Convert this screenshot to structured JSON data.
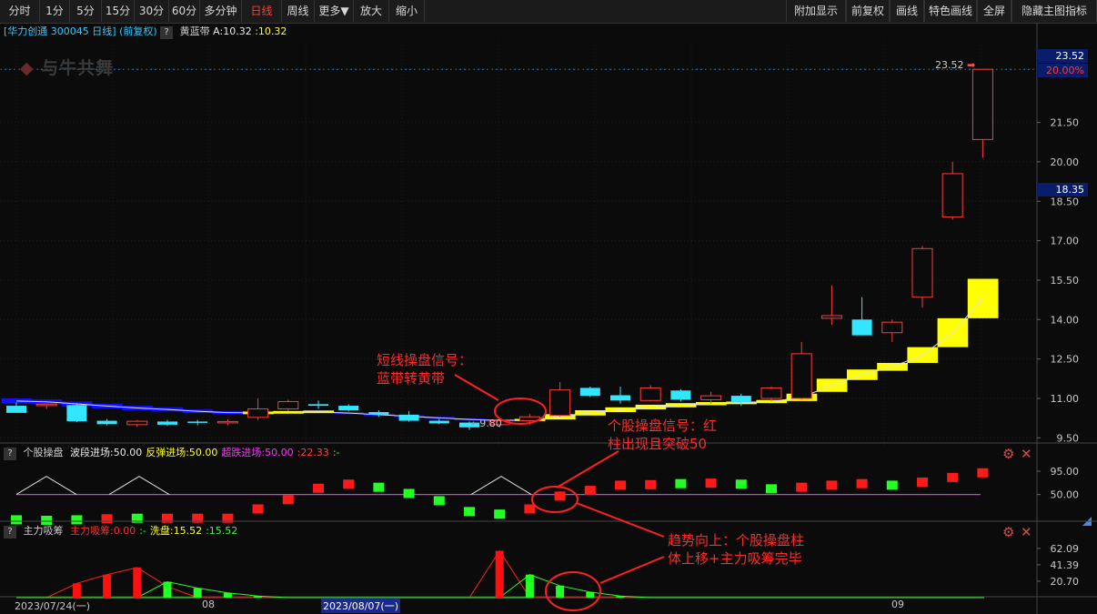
{
  "toolbar": {
    "left": [
      "分时",
      "1分",
      "5分",
      "15分",
      "30分",
      "60分",
      "多分钟",
      "日线",
      "周线",
      "更多▼",
      "放大",
      "缩小"
    ],
    "active": "日线",
    "right": [
      "附加显示",
      "前复权",
      "画线",
      "特色画线",
      "全屏",
      "隐藏主图指标"
    ]
  },
  "main": {
    "stock_label": "[华力创通 300045 日线]",
    "adj_label": "(前复权)",
    "indicator_name": "黄蓝带",
    "indicator_a": "A:10.32",
    "indicator_b": ":10.32",
    "watermark": "与牛共舞",
    "price_high": "23.52",
    "price_low": "9.80",
    "badge_price": "23.52",
    "badge_pct": "20.00%",
    "badge_cursor": "18.35"
  },
  "pane1": {
    "name": "个股操盘",
    "items": [
      {
        "label": "波段进场:50.00",
        "color": "#e8e8e8"
      },
      {
        "label": "反弹进场:50.00",
        "color": "#ffff33"
      },
      {
        "label": "超跌进场:50.00",
        "color": "#ff33ff"
      },
      {
        "label": ":22.33",
        "color": "#ff4040"
      },
      {
        "label": ":-",
        "color": "#33ff33"
      }
    ]
  },
  "pane2": {
    "name": "主力吸筹",
    "items": [
      {
        "label": "主力吸筹:0.00",
        "color": "#ff3030"
      },
      {
        "label": ":-",
        "color": "#33ff33"
      },
      {
        "label": "洗盘:15.52",
        "color": "#ffff33"
      },
      {
        "label": ":15.52",
        "color": "#33ff33"
      }
    ]
  },
  "annotations": [
    {
      "lines": [
        "短线操盘信号：",
        "蓝带转黄带"
      ]
    },
    {
      "lines": [
        "个股操盘信号：红",
        "柱出现且突破50"
      ]
    },
    {
      "lines": [
        "趋势向上：个股操盘柱",
        "体上移+主力吸筹完毕"
      ]
    }
  ],
  "dates": [
    "2023/07/24(一)",
    "08",
    "2023/08/07(一)",
    "09"
  ],
  "chart_data": {
    "type": "candlestick",
    "title": "华力创通 300045 日线",
    "price_axis": {
      "ticks": [
        23.52,
        21.5,
        20.0,
        18.5,
        17.0,
        15.5,
        14.0,
        12.5,
        11.0,
        9.5
      ],
      "ylim": [
        9.2,
        24.6
      ]
    },
    "candles": [
      {
        "o": 10.72,
        "h": 10.85,
        "l": 10.45,
        "c": 10.45
      },
      {
        "o": 10.73,
        "h": 10.8,
        "l": 10.6,
        "c": 10.78
      },
      {
        "o": 10.75,
        "h": 10.78,
        "l": 10.1,
        "c": 10.13
      },
      {
        "o": 10.15,
        "h": 10.22,
        "l": 9.98,
        "c": 10.02
      },
      {
        "o": 10.0,
        "h": 10.18,
        "l": 9.92,
        "c": 10.13
      },
      {
        "o": 10.12,
        "h": 10.18,
        "l": 9.95,
        "c": 10.0
      },
      {
        "o": 10.12,
        "h": 10.18,
        "l": 9.98,
        "c": 10.08
      },
      {
        "o": 10.08,
        "h": 10.2,
        "l": 9.98,
        "c": 10.12
      },
      {
        "o": 10.28,
        "h": 11.0,
        "l": 10.18,
        "c": 10.6
      },
      {
        "o": 10.6,
        "h": 10.95,
        "l": 10.52,
        "c": 10.88
      },
      {
        "o": 10.78,
        "h": 10.92,
        "l": 10.6,
        "c": 10.72
      },
      {
        "o": 10.72,
        "h": 10.78,
        "l": 10.5,
        "c": 10.55
      },
      {
        "o": 10.48,
        "h": 10.55,
        "l": 10.3,
        "c": 10.38
      },
      {
        "o": 10.38,
        "h": 10.52,
        "l": 10.12,
        "c": 10.15
      },
      {
        "o": 10.15,
        "h": 10.22,
        "l": 10.02,
        "c": 10.05
      },
      {
        "o": 10.08,
        "h": 10.12,
        "l": 9.8,
        "c": 9.9
      },
      {
        "o": 10.0,
        "h": 10.25,
        "l": 9.9,
        "c": 10.15
      },
      {
        "o": 10.15,
        "h": 10.4,
        "l": 10.0,
        "c": 10.3
      },
      {
        "o": 10.35,
        "h": 11.62,
        "l": 10.3,
        "c": 11.32
      },
      {
        "o": 11.4,
        "h": 11.45,
        "l": 11.05,
        "c": 11.1
      },
      {
        "o": 11.12,
        "h": 11.45,
        "l": 10.8,
        "c": 10.92
      },
      {
        "o": 10.92,
        "h": 11.5,
        "l": 10.88,
        "c": 11.4
      },
      {
        "o": 11.3,
        "h": 11.35,
        "l": 10.88,
        "c": 10.95
      },
      {
        "o": 10.95,
        "h": 11.25,
        "l": 10.8,
        "c": 11.1
      },
      {
        "o": 11.1,
        "h": 11.18,
        "l": 10.72,
        "c": 10.85
      },
      {
        "o": 11.0,
        "h": 11.45,
        "l": 10.9,
        "c": 11.4
      },
      {
        "o": 11.0,
        "h": 13.15,
        "l": 10.95,
        "c": 12.7
      },
      {
        "o": 14.05,
        "h": 15.3,
        "l": 13.8,
        "c": 14.15
      },
      {
        "o": 14.0,
        "h": 14.85,
        "l": 13.4,
        "c": 13.4
      },
      {
        "o": 13.5,
        "h": 14.0,
        "l": 13.15,
        "c": 13.9
      },
      {
        "o": 14.85,
        "h": 16.8,
        "l": 14.45,
        "c": 16.7
      },
      {
        "o": 17.9,
        "h": 20.0,
        "l": 17.8,
        "c": 19.55
      },
      {
        "o": 20.85,
        "h": 23.52,
        "l": 20.15,
        "c": 23.52
      }
    ],
    "band": [
      {
        "y0": 10.8,
        "y1": 11.0,
        "color": "blue"
      },
      {
        "y0": 10.78,
        "y1": 10.96,
        "color": "blue"
      },
      {
        "y0": 10.7,
        "y1": 10.88,
        "color": "blue"
      },
      {
        "y0": 10.62,
        "y1": 10.8,
        "color": "blue"
      },
      {
        "y0": 10.55,
        "y1": 10.72,
        "color": "blue"
      },
      {
        "y0": 10.5,
        "y1": 10.66,
        "color": "blue"
      },
      {
        "y0": 10.44,
        "y1": 10.58,
        "color": "blue"
      },
      {
        "y0": 10.4,
        "y1": 10.52,
        "color": "blue"
      },
      {
        "y0": 10.4,
        "y1": 10.5,
        "color": "yellow"
      },
      {
        "y0": 10.42,
        "y1": 10.52,
        "color": "yellow"
      },
      {
        "y0": 10.44,
        "y1": 10.54,
        "color": "yellow"
      },
      {
        "y0": 10.4,
        "y1": 10.48,
        "color": "blue"
      },
      {
        "y0": 10.34,
        "y1": 10.42,
        "color": "blue"
      },
      {
        "y0": 10.28,
        "y1": 10.36,
        "color": "blue"
      },
      {
        "y0": 10.22,
        "y1": 10.3,
        "color": "blue"
      },
      {
        "y0": 10.16,
        "y1": 10.24,
        "color": "blue"
      },
      {
        "y0": 10.12,
        "y1": 10.2,
        "color": "blue"
      },
      {
        "y0": 10.14,
        "y1": 10.22,
        "color": "yellow"
      },
      {
        "y0": 10.2,
        "y1": 10.4,
        "color": "yellow"
      },
      {
        "y0": 10.35,
        "y1": 10.55,
        "color": "yellow"
      },
      {
        "y0": 10.48,
        "y1": 10.66,
        "color": "yellow"
      },
      {
        "y0": 10.58,
        "y1": 10.76,
        "color": "yellow"
      },
      {
        "y0": 10.66,
        "y1": 10.82,
        "color": "yellow"
      },
      {
        "y0": 10.74,
        "y1": 10.86,
        "color": "yellow"
      },
      {
        "y0": 10.78,
        "y1": 10.88,
        "color": "yellow"
      },
      {
        "y0": 10.82,
        "y1": 10.94,
        "color": "yellow"
      },
      {
        "y0": 10.9,
        "y1": 11.18,
        "color": "yellow"
      },
      {
        "y0": 11.25,
        "y1": 11.75,
        "color": "yellow"
      },
      {
        "y0": 11.7,
        "y1": 12.1,
        "color": "yellow"
      },
      {
        "y0": 12.05,
        "y1": 12.35,
        "color": "yellow"
      },
      {
        "y0": 12.35,
        "y1": 12.95,
        "color": "yellow"
      },
      {
        "y0": 12.95,
        "y1": 14.05,
        "color": "yellow"
      },
      {
        "y0": 14.05,
        "y1": 15.55,
        "color": "yellow"
      }
    ],
    "pane1": {
      "ticks": [
        95.0,
        50.0
      ],
      "ylim": [
        0,
        118
      ],
      "level": 50,
      "bars": [
        {
          "v": 1,
          "c": "green"
        },
        {
          "v": 0,
          "c": "green"
        },
        {
          "v": 1,
          "c": "green"
        },
        {
          "v": 3,
          "c": "red"
        },
        {
          "v": 4,
          "c": "green"
        },
        {
          "v": 4,
          "c": "red"
        },
        {
          "v": 4,
          "c": "red"
        },
        {
          "v": 4,
          "c": "red"
        },
        {
          "v": 22,
          "c": "red"
        },
        {
          "v": 40,
          "c": "red"
        },
        {
          "v": 62,
          "c": "red"
        },
        {
          "v": 70,
          "c": "red"
        },
        {
          "v": 64,
          "c": "green"
        },
        {
          "v": 52,
          "c": "green"
        },
        {
          "v": 38,
          "c": "green"
        },
        {
          "v": 17,
          "c": "green"
        },
        {
          "v": 12,
          "c": "green"
        },
        {
          "v": 22,
          "c": "red"
        },
        {
          "v": 47,
          "c": "red"
        },
        {
          "v": 58,
          "c": "red"
        },
        {
          "v": 68,
          "c": "red"
        },
        {
          "v": 69,
          "c": "red"
        },
        {
          "v": 71,
          "c": "green"
        },
        {
          "v": 72,
          "c": "red"
        },
        {
          "v": 70,
          "c": "green"
        },
        {
          "v": 61,
          "c": "green"
        },
        {
          "v": 64,
          "c": "red"
        },
        {
          "v": 68,
          "c": "red"
        },
        {
          "v": 71,
          "c": "red"
        },
        {
          "v": 68,
          "c": "green"
        },
        {
          "v": 74,
          "c": "red"
        },
        {
          "v": 83,
          "c": "red"
        },
        {
          "v": 92,
          "c": "red"
        }
      ]
    },
    "pane2": {
      "ticks": [
        62.09,
        41.39,
        20.7
      ],
      "ylim": [
        0,
        70
      ],
      "red": [
        0,
        0,
        18,
        29,
        38,
        14,
        0,
        0,
        0,
        0,
        0,
        0,
        0,
        0,
        0,
        0,
        59,
        0,
        0,
        0,
        0,
        0,
        0,
        0,
        0,
        0,
        0,
        0,
        0,
        0,
        0,
        0,
        0
      ],
      "green": [
        0,
        0,
        0,
        0,
        0,
        20,
        12,
        6,
        2,
        0,
        0,
        0,
        0,
        0,
        0,
        0,
        0,
        29,
        15,
        7,
        2,
        0,
        0,
        0,
        0,
        0,
        0,
        0,
        0,
        0,
        0,
        0,
        0
      ]
    }
  }
}
